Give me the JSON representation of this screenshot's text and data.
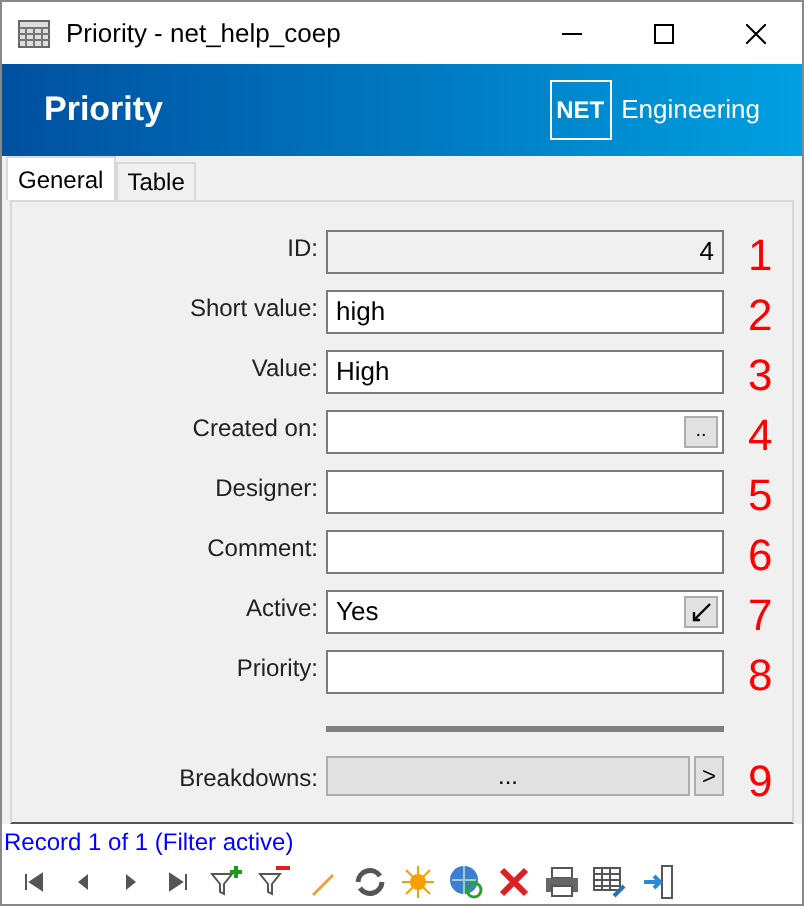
{
  "window": {
    "title": "Priority - net_help_coep"
  },
  "banner": {
    "title": "Priority",
    "logo_mark": "NET",
    "logo_text": "Engineering"
  },
  "tabs": [
    {
      "label": "General",
      "selected": true
    },
    {
      "label": "Table",
      "selected": false
    }
  ],
  "fields": [
    {
      "label": "ID:",
      "value": "4",
      "kind": "readonly",
      "marker": "1"
    },
    {
      "label": "Short value:",
      "value": "high",
      "kind": "text",
      "marker": "2"
    },
    {
      "label": "Value:",
      "value": "High",
      "kind": "text",
      "marker": "3"
    },
    {
      "label": "Created on:",
      "kind": "date",
      "button": "..",
      "marker": "4"
    },
    {
      "label": "Designer:",
      "kind": "text",
      "marker": "5"
    },
    {
      "label": "Comment:",
      "kind": "text",
      "marker": "6"
    },
    {
      "label": "Active:",
      "value": "Yes",
      "kind": "checkbox",
      "checked": true,
      "marker": "7"
    },
    {
      "label": "Priority:",
      "kind": "text",
      "marker": "8"
    },
    {
      "label": "Breakdowns:",
      "kind": "subform",
      "value": "...",
      "button": ">",
      "marker": "9"
    }
  ],
  "status": "Record 1 of 1 (Filter active)"
}
